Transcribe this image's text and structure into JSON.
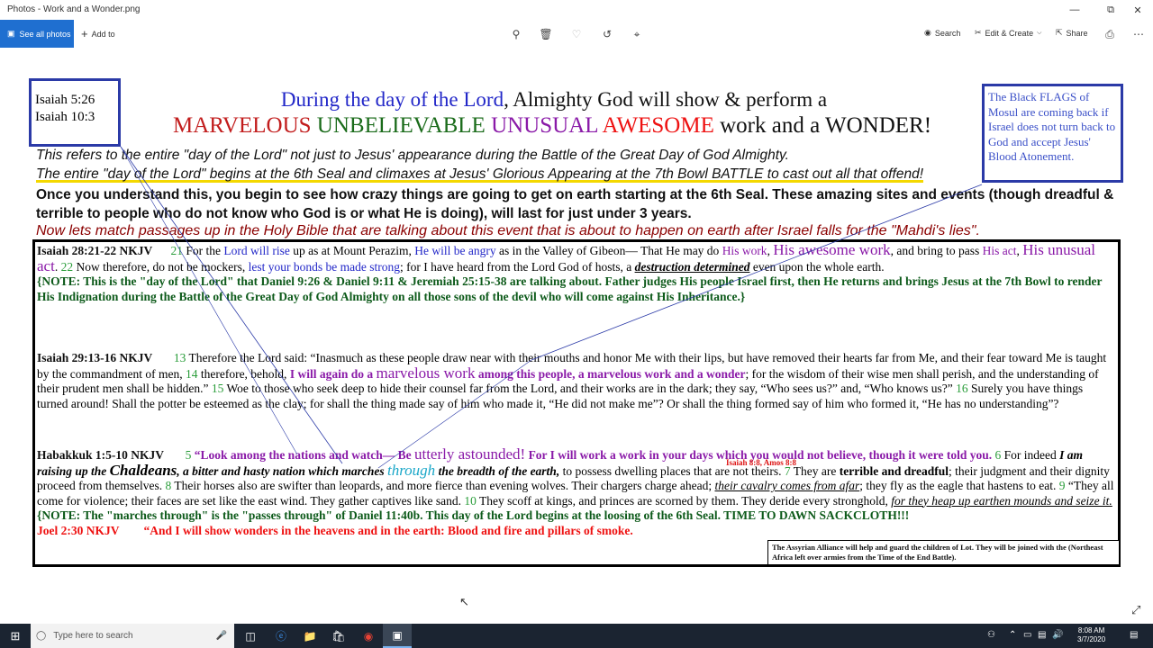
{
  "window": {
    "title": "Photos - Work and a Wonder.png"
  },
  "toolbar": {
    "see_all_photos": "See all photos",
    "add_to": "Add to",
    "search": "Search",
    "edit_create": "Edit & Create",
    "share": "Share"
  },
  "image": {
    "ref_box": [
      "Isaiah 5:26",
      "Isaiah 10:3"
    ],
    "flags_box": "The Black FLAGS of Mosul are coming back if Israel does not turn back to God and accept Jesus' Blood Atonement.",
    "heading1": {
      "part1": "During the day of the Lord",
      "part2": ", Almighty God will show & perform a"
    },
    "heading2": {
      "w1": "MARVELOUS",
      "w2": "UNBELIEVABLE",
      "w3": "UNUSUAL",
      "w4": "AWESOME",
      "w5": "work and a WONDER!"
    },
    "intro1": "This refers to the entire \"day of the Lord\" not just to Jesus' appearance during the Battle of the Great Day of God Almighty.",
    "intro2": "The entire \"day of the Lord\" begins at the 6th Seal and climaxes at Jesus' Glorious Appearing at the 7th Bowl BATTLE to cast out all that offend!",
    "intro3": "Once you understand this, you begin to see how crazy things are going to get on earth starting at the 6th Seal. These amazing sites and events (though dreadful & terrible to people who do not know who God is or what He is doing), will last for just under 3 years.",
    "intro4": "Now lets match passages up in the Holy Bible that are talking about this event that is about to happen on earth after Israel falls for the \"Mahdi's lies\".",
    "isaiah28": {
      "ref": "Isaiah 28:21-22 NKJV",
      "v21": "21",
      "t1": "For the",
      "t2": "Lord will rise",
      "t3": "up as at Mount Perazim,",
      "t4": "He will be angry",
      "t5": "as in the Valley of Gibeon— That He may do",
      "t6": "His work",
      "t7": ",",
      "t8": "His awesome work",
      "t9": ", and bring to pass",
      "t10": "His act",
      "t11": ",",
      "t12": "His unusual act",
      "t13": ".",
      "v22": "22",
      "t14": "Now therefore, do not be mockers,",
      "t15": "lest your bonds be made strong",
      "t16": "; for I have heard from the Lord God of hosts, a",
      "t17": "destruction determined",
      "t18": "even upon the whole earth.",
      "note": "{NOTE: This is the \"day of the Lord\" that Daniel 9:26 & Daniel 9:11 & Jeremiah 25:15-38 are talking about. Father judges His people Israel first, then He returns and brings Jesus at the 7th Bowl to render His Indignation during the Battle of the Great Day of God Almighty on all those sons of the devil who will come against His Inheritance.}"
    },
    "isaiah29": {
      "ref": "Isaiah 29:13-16 NKJV",
      "v13": "13",
      "t1": "Therefore the Lord said: “Inasmuch as these people draw near with their mouths and honor Me with their lips, but have removed their hearts far from Me, and their fear toward Me is taught by the commandment of men,",
      "v14": "14",
      "t2": "therefore, behold,",
      "t3": "I will again do a",
      "t4": "marvelous work",
      "t5": "among this people,  a marvelous work and a wonder",
      "t6": "; for the wisdom of their wise men shall perish, and the understanding of their prudent men shall be hidden.”",
      "v15": "15",
      "t7": "Woe to those who seek deep to hide their counsel far from the Lord, and their works are in the dark; they say, “Who sees us?” and, “Who knows us?”",
      "v16": "16",
      "t8": "Surely you have things turned around! Shall the potter be esteemed as the clay; for shall the thing made say of him who made it, “He did not make me”? Or shall the thing formed say of him who formed it, “He has no understanding”?"
    },
    "habakkuk": {
      "ref": "Habakkuk 1:5-10 NKJV",
      "v5": "5",
      "t1": "“Look among the nations and watch— Be",
      "t2": "utterly astounded!",
      "t3": "For I will work a work in your days which you would not believe, though it were told you.",
      "v6": "6",
      "t4": "For indeed",
      "t5": "I am raising up the",
      "t6": "Chaldeans",
      "t7": ", a bitter and hasty nation which marches",
      "t8": "through",
      "t9": "the breadth of the earth,",
      "t10": "to possess dwelling places that are not theirs.",
      "v7": "7",
      "t11": "They are",
      "t12": "terrible and dreadful",
      "t13": "; their judgment and their dignity proceed from themselves.",
      "v8": "8",
      "t14": "Their horses also are swifter than leopards, and more fierce than evening wolves. Their chargers charge ahead;",
      "t15": "their cavalry comes from afar",
      "t16": "; they fly as the eagle that hastens to eat.",
      "v9": "9",
      "t17": "“They all come for violence; their faces are set like the east wind. They gather captives like sand.",
      "v10": "10",
      "t18": "They scoff at kings, and princes are scorned by them. They deride every stronghold,",
      "t19": "for they heap up earthen mounds and seize it.",
      "note": "{NOTE: The \"marches through\" is the \"passes through\" of Daniel 11:40b. This day of the Lord begins at the loosing of the 6th Seal. TIME TO DAWN SACKCLOTH!!!"
    },
    "tiny_ref": "Isaiah 8:8, Amos 8:8",
    "joel": {
      "ref": "Joel 2:30 NKJV",
      "text": "“And I will show wonders in the heavens and in the earth: Blood and fire and pillars of smoke."
    },
    "assyrian": "The Assyrian Alliance will help and guard the children of Lot. They will be joined with the (Northeast Africa left over armies from the Time of the End Battle)."
  },
  "taskbar": {
    "search_placeholder": "Type here to search",
    "time": "8:08 AM",
    "date": "3/7/2020"
  },
  "colors": {
    "accent": "#1f6fd0",
    "box_border": "#2b3aa7",
    "taskbar": "#1b2431"
  }
}
